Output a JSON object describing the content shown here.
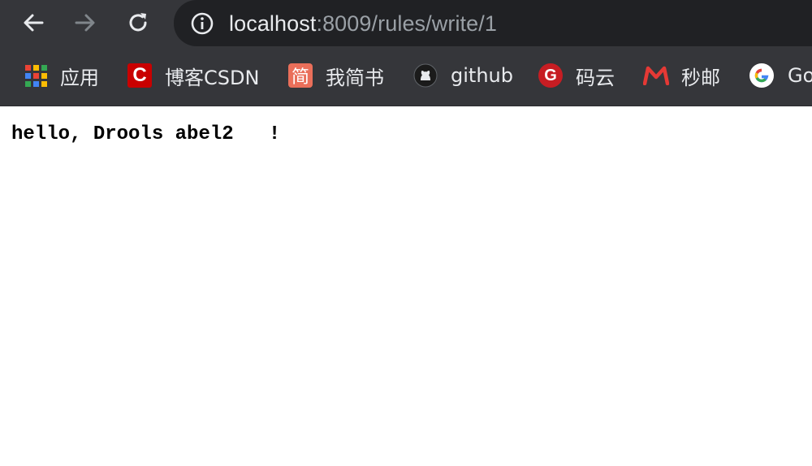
{
  "browser": {
    "url_host": "localhost",
    "url_path": ":8009/rules/write/1"
  },
  "bookmarks": [
    {
      "label": "应用",
      "icon": "apps-grid-icon"
    },
    {
      "label": "博客CSDN",
      "icon": "csdn-icon",
      "icon_glyph": "C",
      "color": "#c90000"
    },
    {
      "label": "我简书",
      "icon": "jianshu-icon",
      "icon_glyph": "简",
      "color": "#ea6f5a"
    },
    {
      "label": "github",
      "icon": "github-icon"
    },
    {
      "label": "码云",
      "icon": "gitee-icon",
      "icon_glyph": "G",
      "color": "#c71d23"
    },
    {
      "label": "秒邮",
      "icon": "miaoyou-icon",
      "color": "#e53935"
    },
    {
      "label": "Go",
      "icon": "google-icon"
    }
  ],
  "page": {
    "message": "hello, Drools abel2   !"
  }
}
